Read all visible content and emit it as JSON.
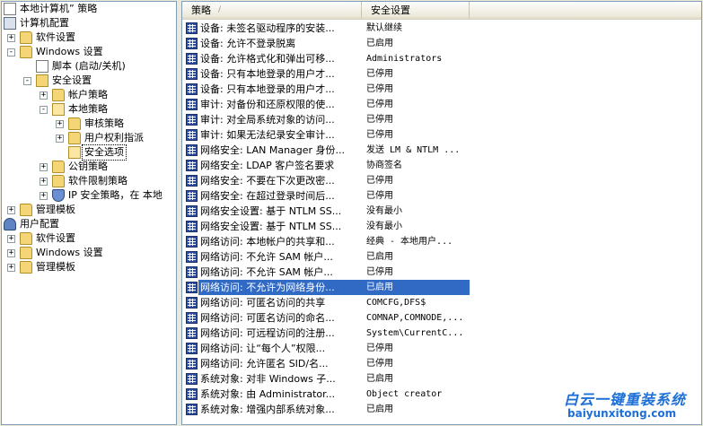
{
  "tree": {
    "items": [
      {
        "label": "本地计算机” 策略",
        "icon": "doc-icon",
        "expander": "",
        "level": 0
      },
      {
        "label": "计算机配置",
        "icon": "computer-icon",
        "expander": "",
        "level": 0
      },
      {
        "label": "软件设置",
        "icon": "folder-icon",
        "expander": "+",
        "level": 1
      },
      {
        "label": "Windows 设置",
        "icon": "folder-icon",
        "expander": "-",
        "level": 1
      },
      {
        "label": "脚本 (启动/关机)",
        "icon": "script-icon",
        "expander": "",
        "level": 2
      },
      {
        "label": "安全设置",
        "icon": "security-settings-icon",
        "expander": "-",
        "level": 2
      },
      {
        "label": "帐户策略",
        "icon": "folder-icon",
        "expander": "+",
        "level": 3
      },
      {
        "label": "本地策略",
        "icon": "folder-open-icon",
        "expander": "-",
        "level": 3
      },
      {
        "label": "审核策略",
        "icon": "folder-icon",
        "expander": "+",
        "level": 4
      },
      {
        "label": "用户权利指派",
        "icon": "folder-icon",
        "expander": "+",
        "level": 4
      },
      {
        "label": "安全选项",
        "icon": "folder-open-icon",
        "expander": "",
        "level": 4,
        "selected": true
      },
      {
        "label": "公钥策略",
        "icon": "folder-icon",
        "expander": "+",
        "level": 3
      },
      {
        "label": "软件限制策略",
        "icon": "folder-icon",
        "expander": "+",
        "level": 3
      },
      {
        "label": "IP 安全策略，在 本地",
        "icon": "ip-security-icon",
        "expander": "+",
        "level": 3
      },
      {
        "label": "管理模板",
        "icon": "folder-icon",
        "expander": "+",
        "level": 1
      },
      {
        "label": "用户配置",
        "icon": "user-icon",
        "expander": "",
        "level": 0
      },
      {
        "label": "软件设置",
        "icon": "folder-icon",
        "expander": "+",
        "level": 1
      },
      {
        "label": "Windows 设置",
        "icon": "folder-icon",
        "expander": "+",
        "level": 1
      },
      {
        "label": "管理模板",
        "icon": "folder-icon",
        "expander": "+",
        "level": 1
      }
    ]
  },
  "list": {
    "columns": [
      "策略",
      "安全设置"
    ],
    "sort_indicator": "/",
    "rows": [
      {
        "policy": "设备: 未签名驱动程序的安装...",
        "setting": "默认继续"
      },
      {
        "policy": "设备: 允许不登录脱离",
        "setting": "已启用"
      },
      {
        "policy": "设备: 允许格式化和弹出可移...",
        "setting": "Administrators"
      },
      {
        "policy": "设备: 只有本地登录的用户才...",
        "setting": "已停用"
      },
      {
        "policy": "设备: 只有本地登录的用户才...",
        "setting": "已停用"
      },
      {
        "policy": "审计: 对备份和还原权限的使...",
        "setting": "已停用"
      },
      {
        "policy": "审计: 对全局系统对象的访问...",
        "setting": "已停用"
      },
      {
        "policy": "审计: 如果无法纪录安全审计...",
        "setting": "已停用"
      },
      {
        "policy": "网络安全: LAN Manager 身份...",
        "setting": "发送 LM & NTLM ..."
      },
      {
        "policy": "网络安全: LDAP 客户签名要求",
        "setting": "协商签名"
      },
      {
        "policy": "网络安全: 不要在下次更改密...",
        "setting": "已停用"
      },
      {
        "policy": "网络安全: 在超过登录时间后...",
        "setting": "已停用"
      },
      {
        "policy": "网络安全设置: 基于 NTLM SS...",
        "setting": "没有最小"
      },
      {
        "policy": "网络安全设置: 基于 NTLM SS...",
        "setting": "没有最小"
      },
      {
        "policy": "网络访问: 本地帐户的共享和...",
        "setting": "经典 - 本地用户..."
      },
      {
        "policy": "网络访问: 不允许 SAM 帐户...",
        "setting": "已启用"
      },
      {
        "policy": "网络访问: 不允许 SAM 帐户...",
        "setting": "已停用"
      },
      {
        "policy": "网络访问: 不允许为网络身份...",
        "setting": "已启用",
        "selected": true
      },
      {
        "policy": "网络访问: 可匿名访问的共享",
        "setting": "COMCFG,DFS$"
      },
      {
        "policy": "网络访问: 可匿名访问的命名...",
        "setting": "COMNAP,COMNODE,..."
      },
      {
        "policy": "网络访问: 可远程访问的注册...",
        "setting": "System\\CurrentC..."
      },
      {
        "policy": "网络访问: 让“每个人”权限...",
        "setting": "已停用"
      },
      {
        "policy": "网络访问: 允许匿名 SID/名...",
        "setting": "已停用"
      },
      {
        "policy": "系统对象: 对非 Windows 子...",
        "setting": "已启用"
      },
      {
        "policy": "系统对象: 由 Administrator...",
        "setting": "Object creator"
      },
      {
        "policy": "系统对象: 增强内部系统对象...",
        "setting": "已启用"
      }
    ]
  },
  "watermark": {
    "title": "白云一键重装系统",
    "url": "baiyunxitong.com"
  },
  "colors": {
    "selection": "#316ac5",
    "watermark": "#1e6fd6",
    "policy_icon": "#2f4f9e"
  }
}
